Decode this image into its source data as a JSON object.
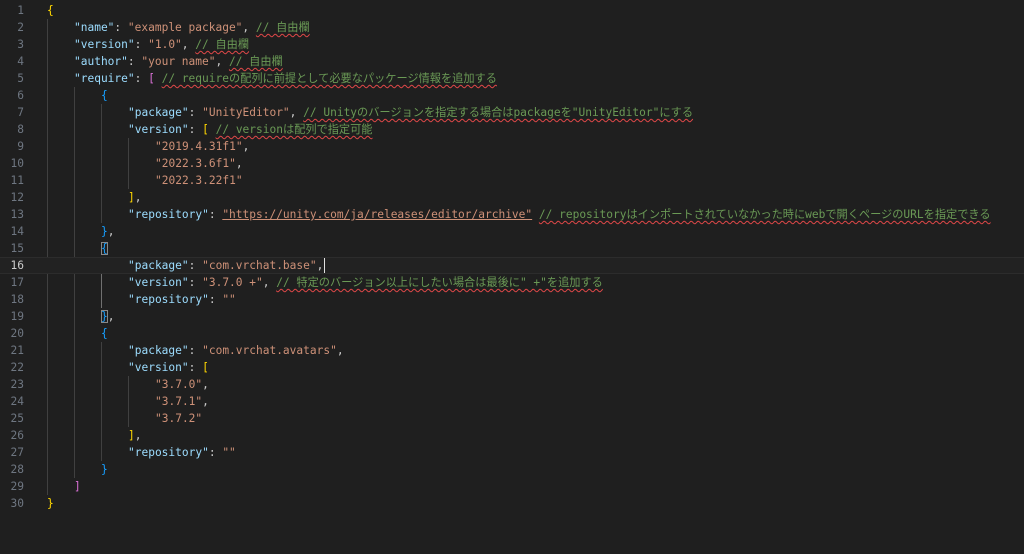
{
  "editor": {
    "current_line": 16,
    "lines": [
      {
        "n": "1",
        "indent": 0,
        "tokens": [
          {
            "t": "{",
            "c": "b1"
          }
        ]
      },
      {
        "n": "2",
        "indent": 1,
        "tokens": [
          {
            "t": "\"name\"",
            "c": "tk-key"
          },
          {
            "t": ": ",
            "c": "tk-punc"
          },
          {
            "t": "\"example package\"",
            "c": "tk-str"
          },
          {
            "t": ", ",
            "c": "tk-punc"
          },
          {
            "t": "// 自由欄",
            "c": "tk-comment"
          }
        ]
      },
      {
        "n": "3",
        "indent": 1,
        "tokens": [
          {
            "t": "\"version\"",
            "c": "tk-key"
          },
          {
            "t": ": ",
            "c": "tk-punc"
          },
          {
            "t": "\"1.0\"",
            "c": "tk-str"
          },
          {
            "t": ", ",
            "c": "tk-punc"
          },
          {
            "t": "// 自由欄",
            "c": "tk-comment"
          }
        ]
      },
      {
        "n": "4",
        "indent": 1,
        "tokens": [
          {
            "t": "\"author\"",
            "c": "tk-key"
          },
          {
            "t": ": ",
            "c": "tk-punc"
          },
          {
            "t": "\"your name\"",
            "c": "tk-str"
          },
          {
            "t": ", ",
            "c": "tk-punc"
          },
          {
            "t": "// 自由欄",
            "c": "tk-comment"
          }
        ]
      },
      {
        "n": "5",
        "indent": 1,
        "tokens": [
          {
            "t": "\"require\"",
            "c": "tk-key"
          },
          {
            "t": ": ",
            "c": "tk-punc"
          },
          {
            "t": "[",
            "c": "b2"
          },
          {
            "t": " ",
            "c": "tk-punc"
          },
          {
            "t": "// requireの配列に前提として必要なパッケージ情報を追加する",
            "c": "tk-comment"
          }
        ]
      },
      {
        "n": "6",
        "indent": 2,
        "tokens": [
          {
            "t": "{",
            "c": "b3"
          }
        ]
      },
      {
        "n": "7",
        "indent": 3,
        "tokens": [
          {
            "t": "\"package\"",
            "c": "tk-key"
          },
          {
            "t": ": ",
            "c": "tk-punc"
          },
          {
            "t": "\"UnityEditor\"",
            "c": "tk-str"
          },
          {
            "t": ", ",
            "c": "tk-punc"
          },
          {
            "t": "// Unityのバージョンを指定する場合はpackageを\"UnityEditor\"にする",
            "c": "tk-comment"
          }
        ]
      },
      {
        "n": "8",
        "indent": 3,
        "tokens": [
          {
            "t": "\"version\"",
            "c": "tk-key"
          },
          {
            "t": ": ",
            "c": "tk-punc"
          },
          {
            "t": "[",
            "c": "b1"
          },
          {
            "t": " ",
            "c": "tk-punc"
          },
          {
            "t": "// versionは配列で指定可能",
            "c": "tk-comment"
          }
        ]
      },
      {
        "n": "9",
        "indent": 4,
        "tokens": [
          {
            "t": "\"2019.4.31f1\"",
            "c": "tk-str"
          },
          {
            "t": ",",
            "c": "tk-punc"
          }
        ]
      },
      {
        "n": "10",
        "indent": 4,
        "tokens": [
          {
            "t": "\"2022.3.6f1\"",
            "c": "tk-str"
          },
          {
            "t": ",",
            "c": "tk-punc"
          }
        ]
      },
      {
        "n": "11",
        "indent": 4,
        "tokens": [
          {
            "t": "\"2022.3.22f1\"",
            "c": "tk-str"
          }
        ]
      },
      {
        "n": "12",
        "indent": 3,
        "tokens": [
          {
            "t": "]",
            "c": "b1"
          },
          {
            "t": ",",
            "c": "tk-punc"
          }
        ]
      },
      {
        "n": "13",
        "indent": 3,
        "tokens": [
          {
            "t": "\"repository\"",
            "c": "tk-key"
          },
          {
            "t": ": ",
            "c": "tk-punc"
          },
          {
            "t": "\"https://unity.com/ja/releases/editor/archive\"",
            "c": "tk-url"
          },
          {
            "t": " ",
            "c": "tk-punc"
          },
          {
            "t": "// repositoryはインポートされていなかった時にwebで開くページのURLを指定できる",
            "c": "tk-comment"
          }
        ]
      },
      {
        "n": "14",
        "indent": 2,
        "tokens": [
          {
            "t": "}",
            "c": "b3"
          },
          {
            "t": ",",
            "c": "tk-punc"
          }
        ]
      },
      {
        "n": "15",
        "indent": 2,
        "tokens": [
          {
            "t": "{",
            "c": "b3 bracket-match"
          }
        ]
      },
      {
        "n": "16",
        "indent": 3,
        "tokens": [
          {
            "t": "\"package\"",
            "c": "tk-key"
          },
          {
            "t": ": ",
            "c": "tk-punc"
          },
          {
            "t": "\"com.vrchat.base\"",
            "c": "tk-str"
          },
          {
            "t": ",",
            "c": "tk-punc"
          }
        ]
      },
      {
        "n": "17",
        "indent": 3,
        "tokens": [
          {
            "t": "\"version\"",
            "c": "tk-key"
          },
          {
            "t": ": ",
            "c": "tk-punc"
          },
          {
            "t": "\"3.7.0 +\"",
            "c": "tk-str"
          },
          {
            "t": ", ",
            "c": "tk-punc"
          },
          {
            "t": "// 特定のバージョン以上にしたい場合は最後に\" +\"を追加する",
            "c": "tk-comment"
          }
        ]
      },
      {
        "n": "18",
        "indent": 3,
        "tokens": [
          {
            "t": "\"repository\"",
            "c": "tk-key"
          },
          {
            "t": ": ",
            "c": "tk-punc"
          },
          {
            "t": "\"\"",
            "c": "tk-str"
          }
        ]
      },
      {
        "n": "19",
        "indent": 2,
        "tokens": [
          {
            "t": "}",
            "c": "b3 bracket-match"
          },
          {
            "t": ",",
            "c": "tk-punc"
          }
        ]
      },
      {
        "n": "20",
        "indent": 2,
        "tokens": [
          {
            "t": "{",
            "c": "b3"
          }
        ]
      },
      {
        "n": "21",
        "indent": 3,
        "tokens": [
          {
            "t": "\"package\"",
            "c": "tk-key"
          },
          {
            "t": ": ",
            "c": "tk-punc"
          },
          {
            "t": "\"com.vrchat.avatars\"",
            "c": "tk-str"
          },
          {
            "t": ",",
            "c": "tk-punc"
          }
        ]
      },
      {
        "n": "22",
        "indent": 3,
        "tokens": [
          {
            "t": "\"version\"",
            "c": "tk-key"
          },
          {
            "t": ": ",
            "c": "tk-punc"
          },
          {
            "t": "[",
            "c": "b1"
          }
        ]
      },
      {
        "n": "23",
        "indent": 4,
        "tokens": [
          {
            "t": "\"3.7.0\"",
            "c": "tk-str"
          },
          {
            "t": ",",
            "c": "tk-punc"
          }
        ]
      },
      {
        "n": "24",
        "indent": 4,
        "tokens": [
          {
            "t": "\"3.7.1\"",
            "c": "tk-str"
          },
          {
            "t": ",",
            "c": "tk-punc"
          }
        ]
      },
      {
        "n": "25",
        "indent": 4,
        "tokens": [
          {
            "t": "\"3.7.2\"",
            "c": "tk-str"
          }
        ]
      },
      {
        "n": "26",
        "indent": 3,
        "tokens": [
          {
            "t": "]",
            "c": "b1"
          },
          {
            "t": ",",
            "c": "tk-punc"
          }
        ]
      },
      {
        "n": "27",
        "indent": 3,
        "tokens": [
          {
            "t": "\"repository\"",
            "c": "tk-key"
          },
          {
            "t": ": ",
            "c": "tk-punc"
          },
          {
            "t": "\"\"",
            "c": "tk-str"
          }
        ]
      },
      {
        "n": "28",
        "indent": 2,
        "tokens": [
          {
            "t": "}",
            "c": "b3"
          }
        ]
      },
      {
        "n": "29",
        "indent": 1,
        "tokens": [
          {
            "t": "]",
            "c": "b2"
          }
        ]
      },
      {
        "n": "30",
        "indent": 0,
        "tokens": [
          {
            "t": "}",
            "c": "b1"
          }
        ]
      }
    ]
  },
  "colors": {
    "background": "#1f1f1f",
    "key": "#9cdcfe",
    "string": "#ce9178",
    "comment": "#6a9955",
    "bracket_level1": "#ffd700",
    "bracket_level2": "#da70d6",
    "bracket_level3": "#179fff",
    "line_number": "#6e7681",
    "spellcheck_underline": "#e04848"
  }
}
